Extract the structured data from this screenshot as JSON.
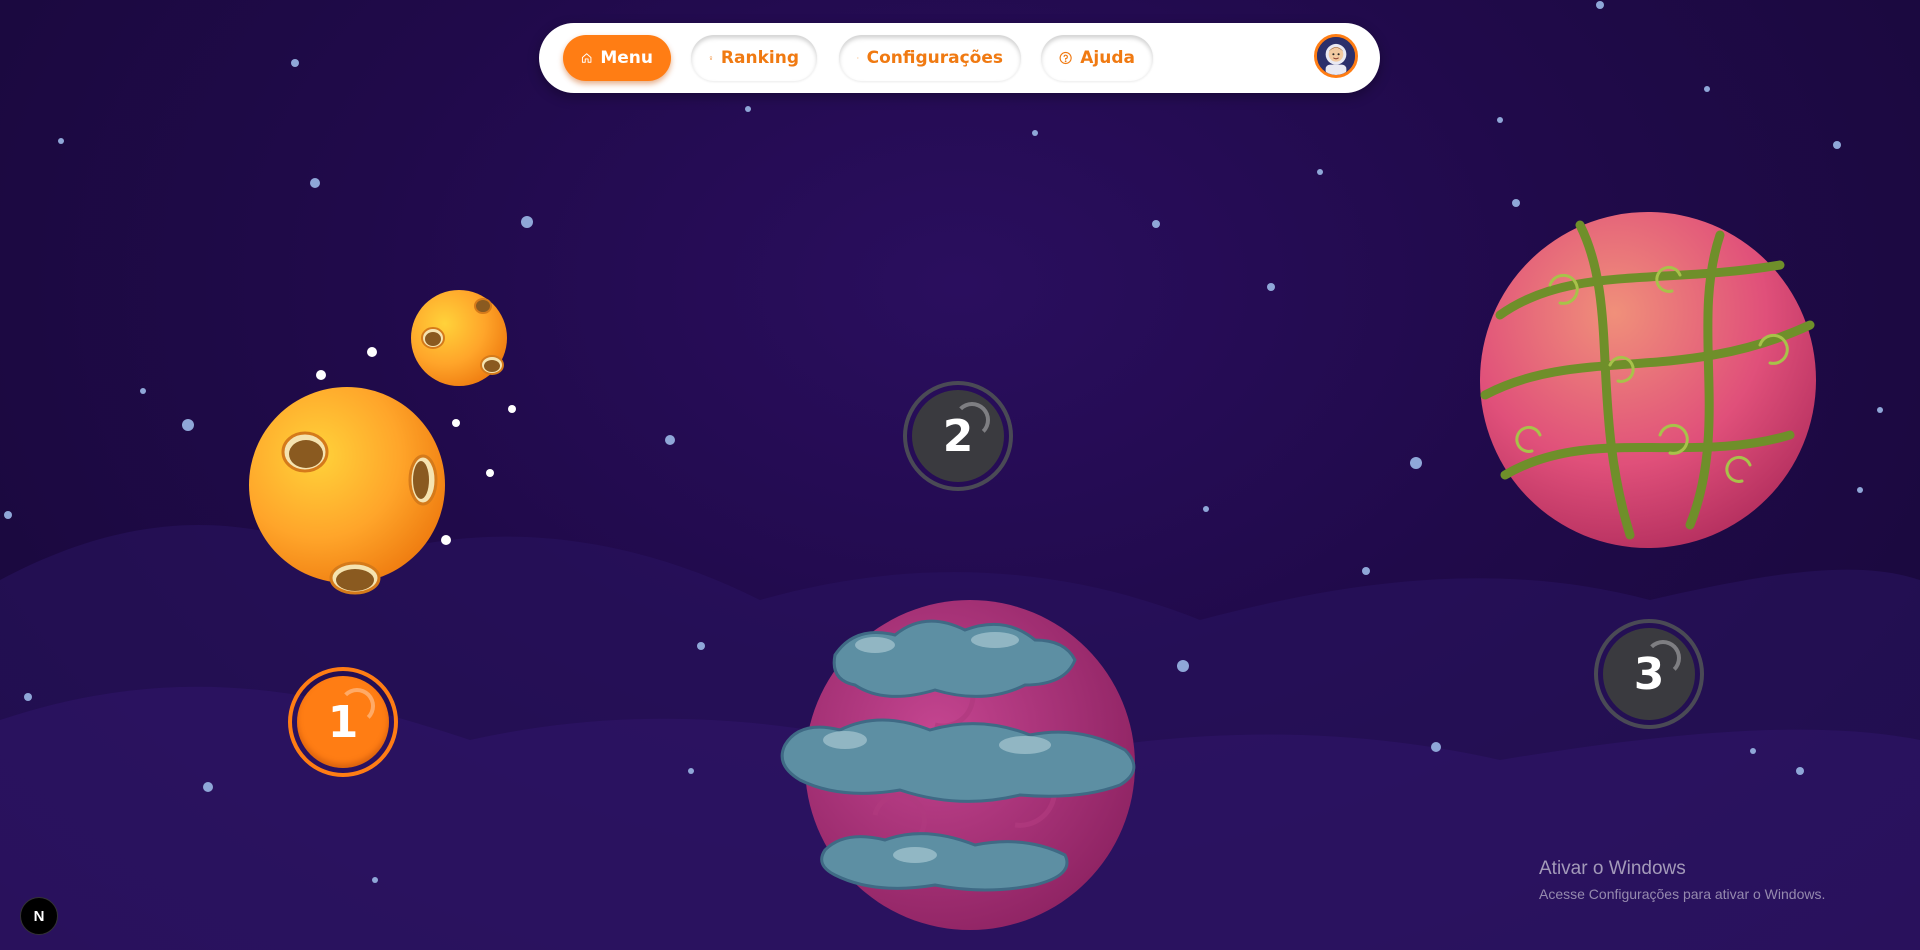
{
  "nav": {
    "items": [
      {
        "label": "Menu",
        "icon": "home-icon",
        "active": true
      },
      {
        "label": "Ranking",
        "icon": "award-icon",
        "active": false
      },
      {
        "label": "Configurações",
        "icon": "settings-icon",
        "active": false
      },
      {
        "label": "Ajuda",
        "icon": "help-icon",
        "active": false
      }
    ],
    "avatar_icon": "astronaut-avatar"
  },
  "levels": [
    {
      "number": "1",
      "status": "unlocked",
      "planet": "yellow-crater-planet"
    },
    {
      "number": "2",
      "status": "locked",
      "planet": "pink-cloud-planet"
    },
    {
      "number": "3",
      "status": "locked",
      "planet": "pink-vine-planet"
    }
  ],
  "colors": {
    "accent": "#ff7d14",
    "background": "#200a4a",
    "locked": "#3a3a3f"
  },
  "watermark": {
    "title": "Ativar o Windows",
    "subtitle": "Acesse Configurações para ativar o Windows."
  },
  "badge": {
    "label": "N"
  }
}
